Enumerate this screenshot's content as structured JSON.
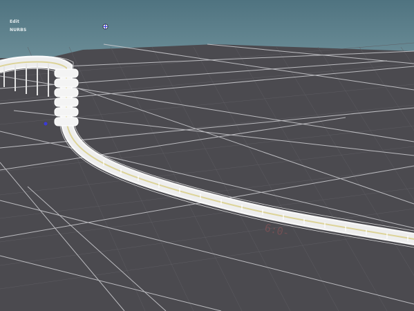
{
  "viewport": {
    "mode_label": "Edit",
    "type_label": "NURBS",
    "floor_marking": "6:0-",
    "colors": {
      "sky": "#5d7f8a",
      "ground": "#4b4a4f",
      "grid_major": "#c9c9cd",
      "grid_minor": "#5e5d63",
      "wire": "#ffffff",
      "rail_accent": "#d9cf8a",
      "floor_marking": "#7a5256",
      "manipulator": "#3a3ad8"
    },
    "icons": [
      "transform-gizmo-icon",
      "pivot-marker-icon"
    ]
  }
}
